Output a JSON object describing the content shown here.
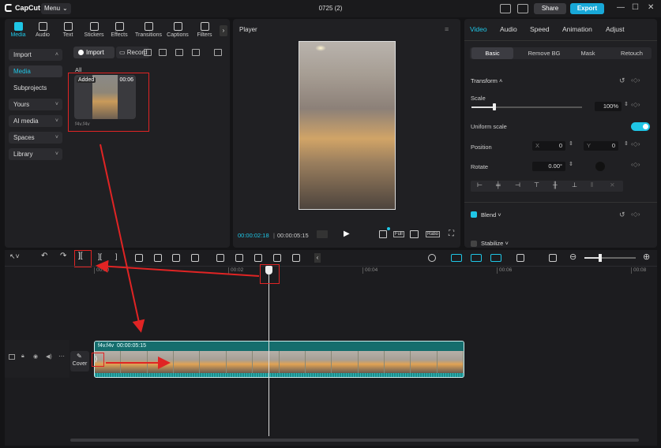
{
  "app": {
    "logo": "CapCut",
    "menu_label": "Menu",
    "window_title": "0725 (2)",
    "share_label": "Share",
    "export_label": "Export"
  },
  "media": {
    "tabs": [
      "Media",
      "Audio",
      "Text",
      "Stickers",
      "Effects",
      "Transitions",
      "Captions",
      "Filters"
    ],
    "sidebar": [
      "Import",
      "Media",
      "Subprojects",
      "Yours",
      "AI media",
      "Spaces",
      "Library"
    ],
    "import_label": "Import",
    "record_label": "Record",
    "filter_label": "All",
    "clip": {
      "badge": "Added",
      "duration": "00:06",
      "filename": "f4v.f4v"
    }
  },
  "player": {
    "title": "Player",
    "current_time": "00:00:02:18",
    "total_time": "00:00:05:15",
    "full_label": "Full",
    "ratio_label": "Ratio"
  },
  "props": {
    "tabs": [
      "Video",
      "Audio",
      "Speed",
      "Animation",
      "Adjust"
    ],
    "subtabs": [
      "Basic",
      "Remove BG",
      "Mask",
      "Retouch"
    ],
    "transform_label": "Transform",
    "scale_label": "Scale",
    "scale_value": "100%",
    "scale_fraction": 0.2,
    "uniform_scale_label": "Uniform scale",
    "position_label": "Position",
    "x_label": "X",
    "x_value": "0",
    "y_label": "Y",
    "y_value": "0",
    "rotate_label": "Rotate",
    "rotate_value": "0.00°",
    "blend_label": "Blend",
    "stabilize_label": "Stabilize"
  },
  "timeline": {
    "ruler": [
      "00:00",
      "00:02",
      "00:04",
      "00:06",
      "00:08"
    ],
    "clip_name": "f4v.f4v",
    "clip_duration": "00:00:05:15",
    "cover_label": "Cover"
  },
  "colors": {
    "accent": "#1fc6e6",
    "clip": "#1c8c8c",
    "highlight": "#e02424"
  }
}
